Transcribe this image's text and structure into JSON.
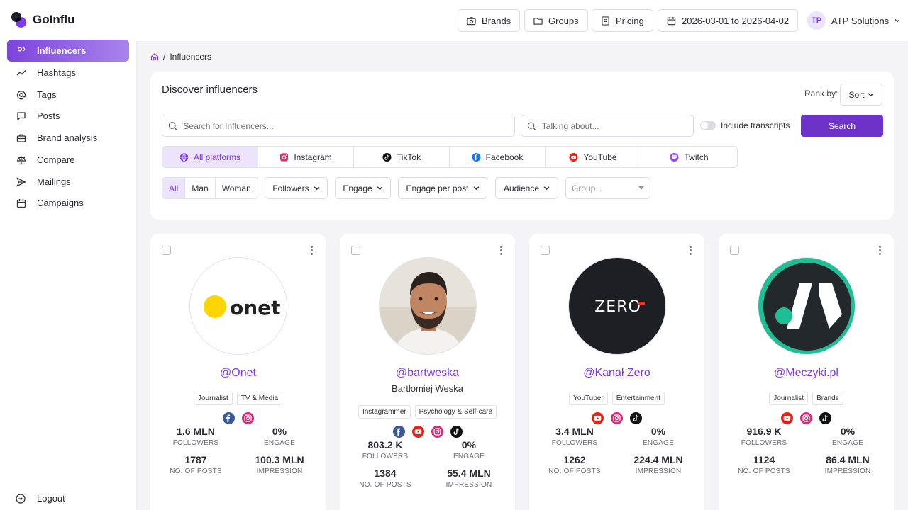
{
  "app": {
    "name": "GoInflu"
  },
  "header": {
    "brands_label": "Brands",
    "groups_label": "Groups",
    "pricing_label": "Pricing",
    "date_range": "2026-03-01 to 2026-04-02",
    "user_initials": "TP",
    "user_name": "ATP Solutions"
  },
  "sidebar": {
    "items": [
      {
        "label": "Influencers",
        "icon": "users-icon",
        "active": true
      },
      {
        "label": "Hashtags",
        "icon": "trend-icon"
      },
      {
        "label": "Tags",
        "icon": "at-icon"
      },
      {
        "label": "Posts",
        "icon": "chat-icon"
      },
      {
        "label": "Brand analysis",
        "icon": "briefcase-icon"
      },
      {
        "label": "Compare",
        "icon": "scales-icon"
      },
      {
        "label": "Mailings",
        "icon": "send-icon"
      },
      {
        "label": "Campaigns",
        "icon": "calendar-icon"
      }
    ],
    "logout_label": "Logout"
  },
  "breadcrumb": {
    "current": "Influencers"
  },
  "discover": {
    "title": "Discover influencers",
    "rank_label": "Rank by:",
    "sort_label": "Sort",
    "search_placeholder": "Search for Influencers...",
    "talking_placeholder": "Talking about...",
    "transcripts_label": "Include transcripts",
    "search_button": "Search",
    "platforms": [
      {
        "label": "All platforms",
        "icon": "globe-icon",
        "color": "#7c3aed",
        "active": true
      },
      {
        "label": "Instagram",
        "icon": "instagram-icon",
        "color": "#d62976"
      },
      {
        "label": "TikTok",
        "icon": "tiktok-icon",
        "color": "#111111"
      },
      {
        "label": "Facebook",
        "icon": "facebook-icon",
        "color": "#1877f2"
      },
      {
        "label": "YouTube",
        "icon": "youtube-icon",
        "color": "#e62117"
      },
      {
        "label": "Twitch",
        "icon": "twitch-icon",
        "color": "#9146ff"
      }
    ],
    "gender": [
      "All",
      "Man",
      "Woman"
    ],
    "filters": [
      "Followers",
      "Engage",
      "Engage per post",
      "Audience"
    ],
    "group_placeholder": "Group..."
  },
  "stat_labels": {
    "followers": "FOLLOWERS",
    "engage": "ENGAGE",
    "posts": "NO. OF POSTS",
    "impression": "IMPRESSION"
  },
  "cards": [
    {
      "handle": "@Onet",
      "name": "",
      "tags": [
        "Journalist",
        "TV & Media"
      ],
      "socials": [
        "facebook",
        "instagram"
      ],
      "followers": "1.6 MLN",
      "engage": "0%",
      "posts": "1787",
      "impression": "100.3 MLN"
    },
    {
      "handle": "@bartweska",
      "name": "Bartłomiej Weska",
      "tags": [
        "Instagrammer",
        "Psychology & Self-care"
      ],
      "socials": [
        "facebook",
        "youtube",
        "instagram",
        "tiktok"
      ],
      "followers": "803.2 K",
      "engage": "0%",
      "posts": "1384",
      "impression": "55.4 MLN"
    },
    {
      "handle": "@Kanał Zero",
      "name": "",
      "tags": [
        "YouTuber",
        "Entertainment"
      ],
      "socials": [
        "youtube",
        "instagram",
        "tiktok"
      ],
      "followers": "3.4 MLN",
      "engage": "0%",
      "posts": "1262",
      "impression": "224.4 MLN"
    },
    {
      "handle": "@Meczyki.pl",
      "name": "",
      "tags": [
        "Journalist",
        "Brands"
      ],
      "socials": [
        "youtube",
        "instagram",
        "tiktok"
      ],
      "followers": "916.9 K",
      "engage": "0%",
      "posts": "1124",
      "impression": "86.4 MLN"
    }
  ],
  "logos": {
    "onet": "onet",
    "zero": "ZERO"
  }
}
